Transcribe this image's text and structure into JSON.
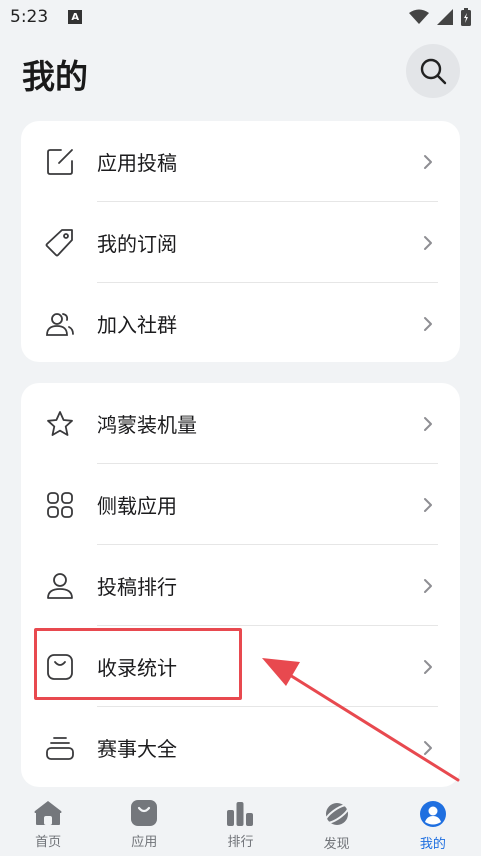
{
  "status_bar": {
    "time": "5:23",
    "notif_badge": "A"
  },
  "page": {
    "title": "我的"
  },
  "group1": [
    {
      "label": "应用投稿",
      "icon": "edit-icon"
    },
    {
      "label": "我的订阅",
      "icon": "tag-icon"
    },
    {
      "label": "加入社群",
      "icon": "group-icon"
    }
  ],
  "group2": [
    {
      "label": "鸿蒙装机量",
      "icon": "star-icon"
    },
    {
      "label": "侧载应用",
      "icon": "grid-icon"
    },
    {
      "label": "投稿排行",
      "icon": "person-icon"
    },
    {
      "label": "收录统计",
      "icon": "bag-icon"
    },
    {
      "label": "赛事大全",
      "icon": "stack-icon"
    }
  ],
  "tabs": [
    {
      "label": "首页",
      "icon": "home-icon"
    },
    {
      "label": "应用",
      "icon": "app-bag-icon"
    },
    {
      "label": "排行",
      "icon": "bar-chart-icon"
    },
    {
      "label": "发现",
      "icon": "planet-icon"
    },
    {
      "label": "我的",
      "icon": "profile-icon",
      "active": true
    }
  ],
  "colors": {
    "accent": "#1f6fe0",
    "highlight": "#e8494f",
    "background": "#f1f3f5"
  }
}
